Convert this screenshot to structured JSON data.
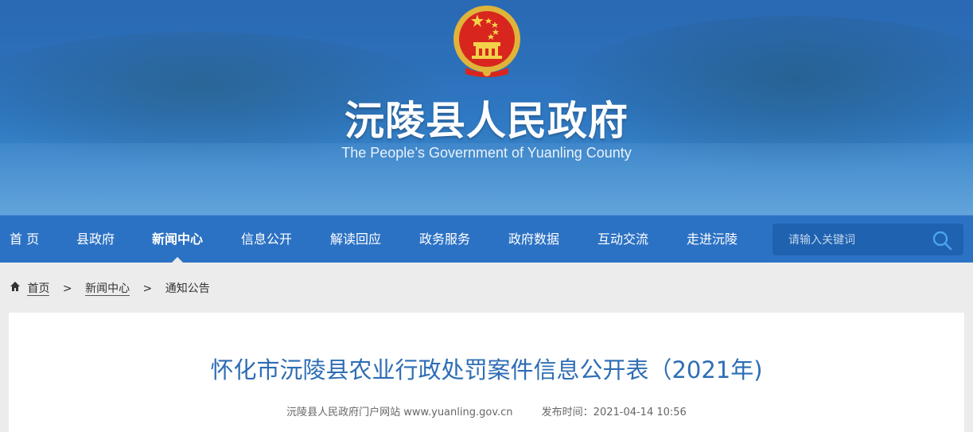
{
  "header": {
    "title": "沅陵县人民政府",
    "subtitle": "The People’s Government of Yuanling County",
    "emblem": "national-emblem"
  },
  "nav": {
    "items": [
      {
        "label": "首 页"
      },
      {
        "label": "县政府"
      },
      {
        "label": "新闻中心",
        "active": true
      },
      {
        "label": "信息公开"
      },
      {
        "label": "解读回应"
      },
      {
        "label": "政务服务"
      },
      {
        "label": "政府数据"
      },
      {
        "label": "互动交流"
      },
      {
        "label": "走进沅陵"
      }
    ],
    "search_placeholder": "请输入关键词",
    "search_icon": "search-icon"
  },
  "breadcrumb": {
    "icon": "home-icon",
    "items": [
      "首页",
      "新闻中心",
      "通知公告"
    ],
    "separator": ">"
  },
  "article": {
    "title": "怀化市沅陵县农业行政处罚案件信息公开表（2021年)",
    "source": "沅陵县人民政府门户网站 www.yuanling.gov.cn",
    "publish_time": "发布时间：2021-04-14 10:56"
  },
  "colors": {
    "nav_bg": "#2c72c4",
    "title_blue": "#2e6db5",
    "page_bg": "#ececec"
  }
}
